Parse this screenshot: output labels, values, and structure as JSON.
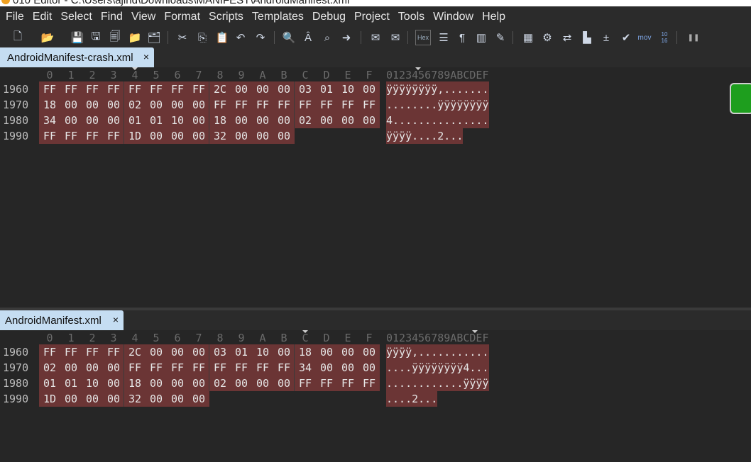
{
  "window": {
    "title": "010 Editor - C:\\Users\\ajind\\Downloads\\MANIFEST\\AndroidManifest.xml"
  },
  "menu": [
    "File",
    "Edit",
    "Select",
    "Find",
    "View",
    "Format",
    "Scripts",
    "Templates",
    "Debug",
    "Project",
    "Tools",
    "Window",
    "Help"
  ],
  "toolbar": {
    "icons": [
      "new-file-icon",
      "open-file-icon",
      "save-icon",
      "save-as-icon",
      "save-all-icon",
      "open-folder-icon",
      "open-project-icon",
      "cut-icon",
      "copy-icon",
      "paste-icon",
      "undo-icon",
      "redo-icon",
      "find-icon",
      "find-replace-icon",
      "find-in-files-icon",
      "goto-icon",
      "compare-icon",
      "compare-folders-icon",
      "hex-view-icon",
      "text-view-icon",
      "show-whitespace-icon",
      "columns-icon",
      "highlight-icon",
      "calculator-icon",
      "template-icon",
      "swap-icon",
      "histogram-icon",
      "arithmetic-icon",
      "checksum-icon",
      "disassembler-icon",
      "base-converter-icon",
      "pause-icon"
    ],
    "hex_label": "Hex",
    "mov_label": "mov",
    "base_label_top": "10",
    "base_label_bottom": "16"
  },
  "hex_columns": [
    "0",
    "1",
    "2",
    "3",
    "4",
    "5",
    "6",
    "7",
    "8",
    "9",
    "A",
    "B",
    "C",
    "D",
    "E",
    "F"
  ],
  "ascii_header": "0123456789ABCDEF",
  "panes": [
    {
      "tab_label": "AndroidManifest-crash.xml",
      "close": "×",
      "rows": [
        {
          "addr": "1960",
          "bytes": [
            "FF",
            "FF",
            "FF",
            "FF",
            "FF",
            "FF",
            "FF",
            "FF",
            "2C",
            "00",
            "00",
            "00",
            "03",
            "01",
            "10",
            "00"
          ],
          "ascii": "ÿÿÿÿÿÿÿÿ,......."
        },
        {
          "addr": "1970",
          "bytes": [
            "18",
            "00",
            "00",
            "00",
            "02",
            "00",
            "00",
            "00",
            "FF",
            "FF",
            "FF",
            "FF",
            "FF",
            "FF",
            "FF",
            "FF"
          ],
          "ascii": "........ÿÿÿÿÿÿÿÿ"
        },
        {
          "addr": "1980",
          "bytes": [
            "34",
            "00",
            "00",
            "00",
            "01",
            "01",
            "10",
            "00",
            "18",
            "00",
            "00",
            "00",
            "02",
            "00",
            "00",
            "00"
          ],
          "ascii": "4..............."
        },
        {
          "addr": "1990",
          "bytes": [
            "FF",
            "FF",
            "FF",
            "FF",
            "1D",
            "00",
            "00",
            "00",
            "32",
            "00",
            "00",
            "00"
          ],
          "ascii": "ÿÿÿÿ....2..."
        }
      ]
    },
    {
      "tab_label": "AndroidManifest.xml",
      "close": "×",
      "rows": [
        {
          "addr": "1960",
          "bytes": [
            "FF",
            "FF",
            "FF",
            "FF",
            "2C",
            "00",
            "00",
            "00",
            "03",
            "01",
            "10",
            "00",
            "18",
            "00",
            "00",
            "00"
          ],
          "ascii": "ÿÿÿÿ,..........."
        },
        {
          "addr": "1970",
          "bytes": [
            "02",
            "00",
            "00",
            "00",
            "FF",
            "FF",
            "FF",
            "FF",
            "FF",
            "FF",
            "FF",
            "FF",
            "34",
            "00",
            "00",
            "00"
          ],
          "ascii": "....ÿÿÿÿÿÿÿÿ4..."
        },
        {
          "addr": "1980",
          "bytes": [
            "01",
            "01",
            "10",
            "00",
            "18",
            "00",
            "00",
            "00",
            "02",
            "00",
            "00",
            "00",
            "FF",
            "FF",
            "FF",
            "FF"
          ],
          "ascii": "............ÿÿÿÿ"
        },
        {
          "addr": "1990",
          "bytes": [
            "1D",
            "00",
            "00",
            "00",
            "32",
            "00",
            "00",
            "00"
          ],
          "ascii": "....2..."
        }
      ]
    }
  ]
}
